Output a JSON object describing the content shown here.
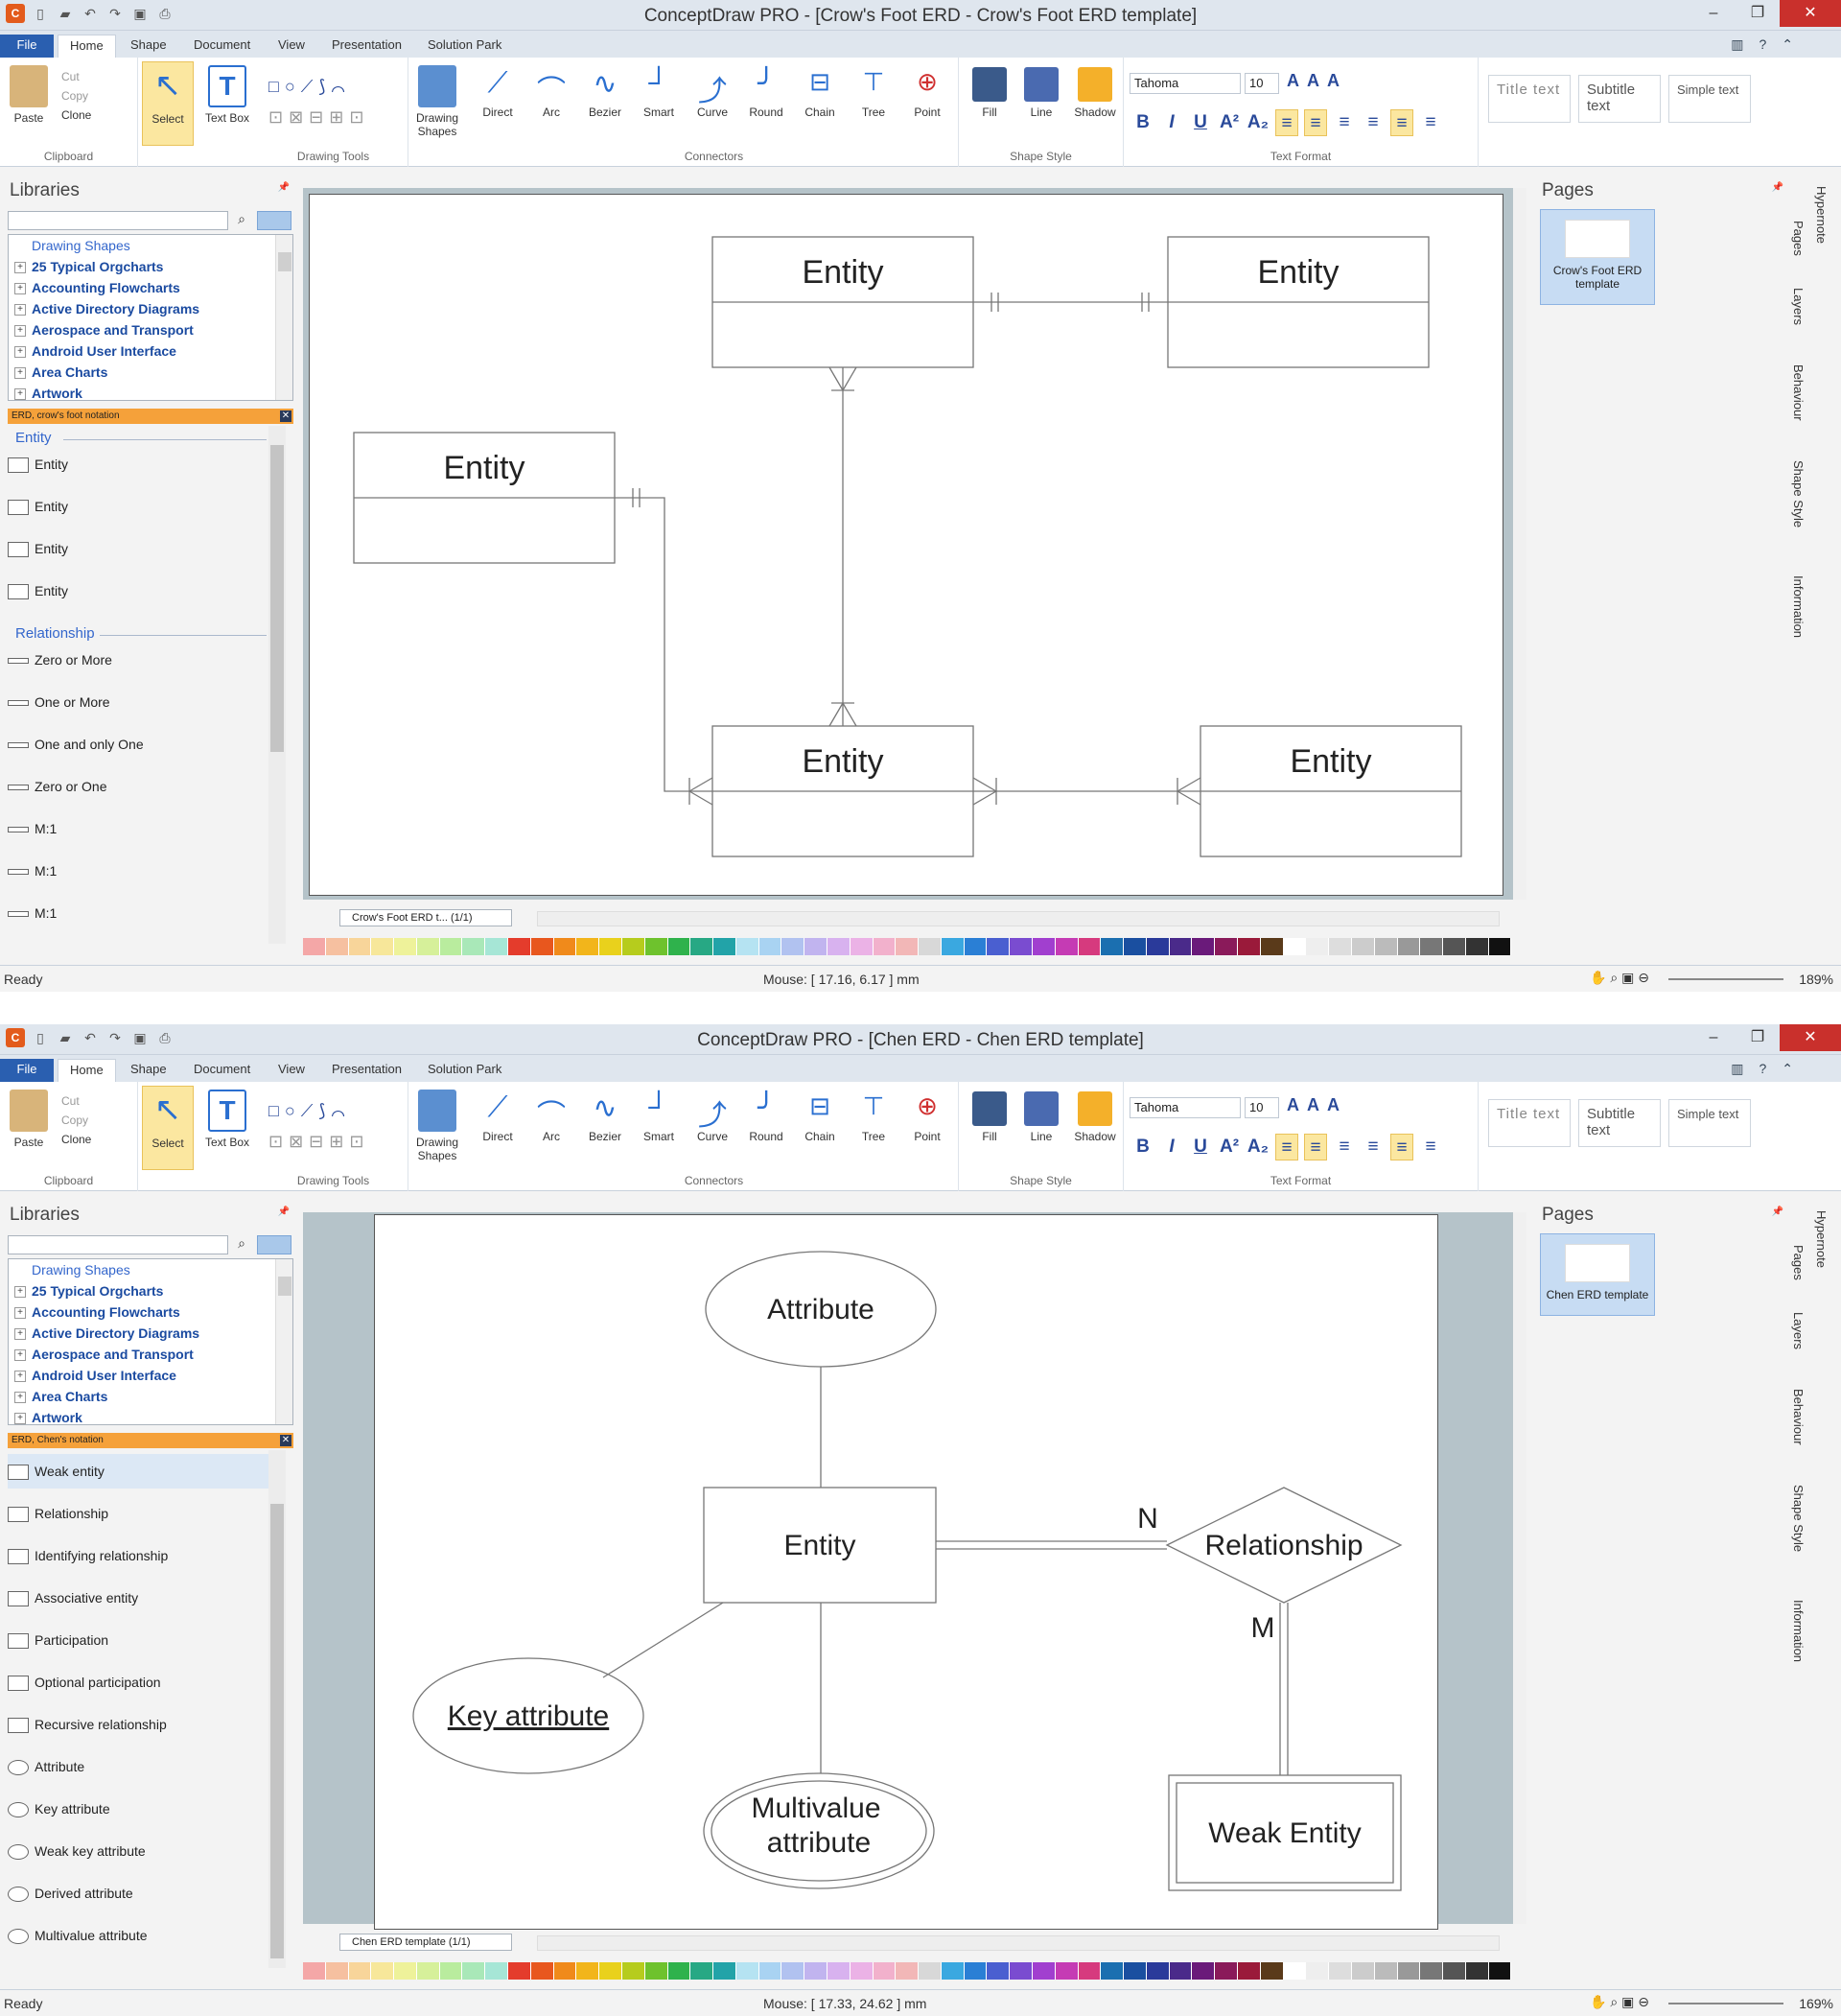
{
  "windows": [
    {
      "title": "ConceptDraw PRO - [Crow's Foot ERD - Crow's Foot ERD template]",
      "tabs": [
        "File",
        "Home",
        "Shape",
        "Document",
        "View",
        "Presentation",
        "Solution Park"
      ],
      "clipboard": {
        "paste": "Paste",
        "cut": "Cut",
        "copy": "Copy",
        "clone": "Clone",
        "select": "Select",
        "textbox": "Text Box",
        "group": "Clipboard"
      },
      "tools": {
        "drawing_shapes": "Drawing Shapes",
        "group": "Drawing Tools"
      },
      "connectors": {
        "items": [
          "Direct",
          "Arc",
          "Bezier",
          "Smart",
          "Curve",
          "Round",
          "Chain",
          "Tree",
          "Point"
        ],
        "group": "Connectors"
      },
      "shape_style": {
        "fill": "Fill",
        "line": "Line",
        "shadow": "Shadow",
        "group": "Shape Style"
      },
      "text_format": {
        "font": "Tahoma",
        "size": "10",
        "group": "Text Format"
      },
      "styles": {
        "title": "Title text",
        "subtitle": "Subtitle text",
        "simple": "Simple text"
      },
      "libraries": {
        "title": "Libraries",
        "tree": [
          "Drawing Shapes",
          "25 Typical Orgcharts",
          "Accounting Flowcharts",
          "Active Directory Diagrams",
          "Aerospace and Transport",
          "Android User Interface",
          "Area Charts",
          "Artwork"
        ],
        "active_library": "ERD, crow's foot notation",
        "sections": [
          {
            "name": "Entity",
            "items": [
              "Entity",
              "Entity",
              "Entity",
              "Entity"
            ]
          },
          {
            "name": "Relationship",
            "items": [
              "Zero or More",
              "One or More",
              "One and only One",
              "Zero or One",
              "M:1",
              "M:1",
              "M:1"
            ]
          }
        ]
      },
      "diagram": {
        "entity_label": "Entity"
      },
      "page_selector": "Crow's Foot ERD t... (1/1)",
      "pages": {
        "title": "Pages",
        "thumb_label": "Crow's Foot ERD template"
      },
      "side_tabs": [
        "Hypernote",
        "Pages",
        "Layers",
        "Behaviour",
        "Shape Style",
        "Information"
      ],
      "status": {
        "ready": "Ready",
        "mouse": "Mouse: [ 17.16, 6.17 ] mm",
        "zoom": "189%"
      }
    },
    {
      "title": "ConceptDraw PRO - [Chen ERD - Chen ERD template]",
      "tabs": [
        "File",
        "Home",
        "Shape",
        "Document",
        "View",
        "Presentation",
        "Solution Park"
      ],
      "clipboard": {
        "paste": "Paste",
        "cut": "Cut",
        "copy": "Copy",
        "clone": "Clone",
        "select": "Select",
        "textbox": "Text Box",
        "group": "Clipboard"
      },
      "tools": {
        "drawing_shapes": "Drawing Shapes",
        "group": "Drawing Tools"
      },
      "connectors": {
        "items": [
          "Direct",
          "Arc",
          "Bezier",
          "Smart",
          "Curve",
          "Round",
          "Chain",
          "Tree",
          "Point"
        ],
        "group": "Connectors"
      },
      "shape_style": {
        "fill": "Fill",
        "line": "Line",
        "shadow": "Shadow",
        "group": "Shape Style"
      },
      "text_format": {
        "font": "Tahoma",
        "size": "10",
        "group": "Text Format"
      },
      "styles": {
        "title": "Title text",
        "subtitle": "Subtitle text",
        "simple": "Simple text"
      },
      "libraries": {
        "title": "Libraries",
        "tree": [
          "Drawing Shapes",
          "25 Typical Orgcharts",
          "Accounting Flowcharts",
          "Active Directory Diagrams",
          "Aerospace and Transport",
          "Android User Interface",
          "Area Charts",
          "Artwork"
        ],
        "active_library": "ERD, Chen's notation",
        "sections": [
          {
            "name": "",
            "items": [
              "Weak entity",
              "Relationship",
              "Identifying relationship",
              "Associative entity",
              "Participation",
              "Optional participation",
              "Recursive relationship",
              "Attribute",
              "Key attribute",
              "Weak key attribute",
              "Derived attribute",
              "Multivalue attribute"
            ]
          }
        ]
      },
      "diagram": {
        "attribute": "Attribute",
        "entity": "Entity",
        "relationship": "Relationship",
        "n": "N",
        "m": "M",
        "key_attribute": "Key attribute",
        "multivalue_1": "Multivalue",
        "multivalue_2": "attribute",
        "weak_entity": "Weak Entity"
      },
      "page_selector": "Chen ERD template (1/1)",
      "pages": {
        "title": "Pages",
        "thumb_label": "Chen ERD template"
      },
      "side_tabs": [
        "Hypernote",
        "Pages",
        "Layers",
        "Behaviour",
        "Shape Style",
        "Information"
      ],
      "status": {
        "ready": "Ready",
        "mouse": "Mouse: [ 17.33, 24.62 ] mm",
        "zoom": "169%"
      }
    }
  ],
  "palette": [
    "#f4a7a7",
    "#f6c0a0",
    "#f8d59a",
    "#f7e79a",
    "#eef29a",
    "#d6f09a",
    "#b9ec9e",
    "#a9e8b8",
    "#a6e6d6",
    "#e43c2c",
    "#e8571e",
    "#f08a1b",
    "#f2b51b",
    "#e9d11c",
    "#b6cc1d",
    "#6ec22d",
    "#2fb24c",
    "#27a884",
    "#22a3a8",
    "#b5e3f2",
    "#a9d3f2",
    "#b1c2f0",
    "#c1b4ef",
    "#d8b2ef",
    "#ebb2e6",
    "#f2b1cc",
    "#f2b7b7",
    "#d8d8d8",
    "#3aa8e0",
    "#2a7fd5",
    "#4a5fd0",
    "#7a4cd0",
    "#a13fcf",
    "#c53bb4",
    "#d63a7e",
    "#1b6fb0",
    "#1a4fa0",
    "#2a3a9a",
    "#4a2a8a",
    "#6a1a7a",
    "#8a1a5a",
    "#9a1a3a",
    "#5a3a1a",
    "#ffffff",
    "#eeeeee",
    "#dddddd",
    "#cccccc",
    "#bbbbbb",
    "#999999",
    "#777777",
    "#555555",
    "#333333",
    "#111111"
  ]
}
